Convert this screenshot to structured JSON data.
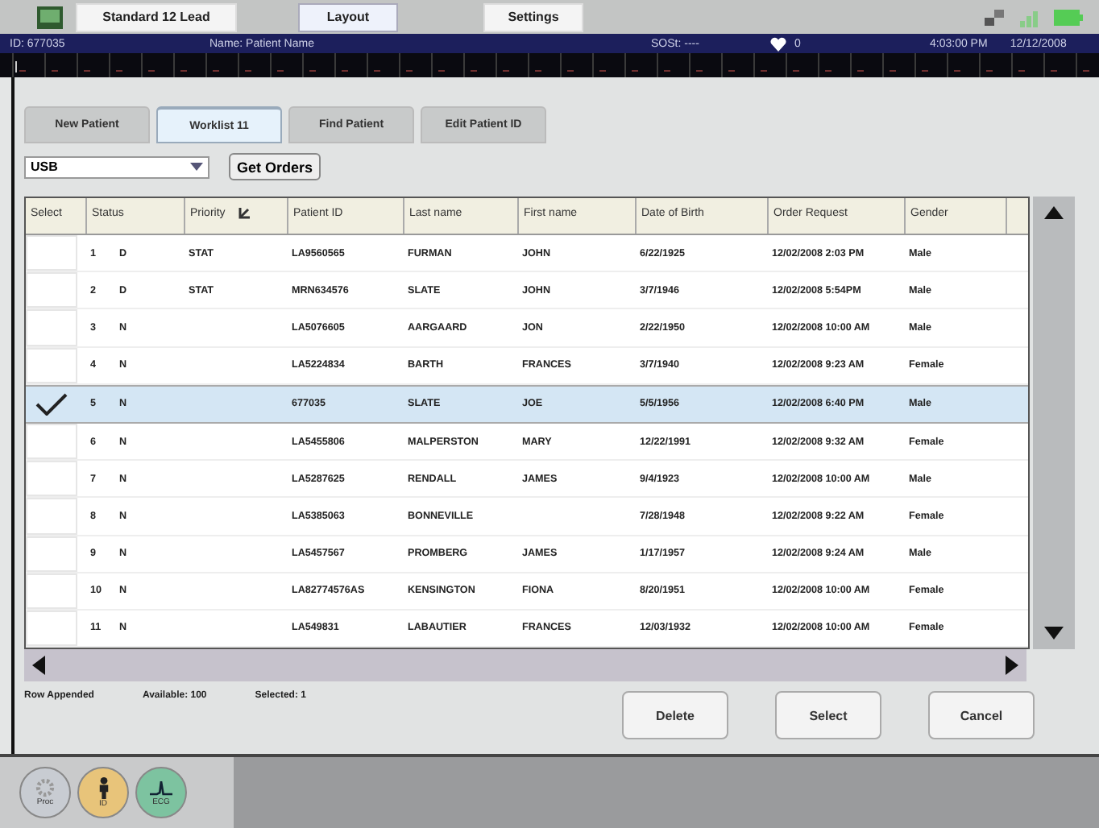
{
  "toolbar": {
    "buttons": [
      {
        "label": "Standard 12 Lead",
        "selected": false
      },
      {
        "label": "Layout",
        "selected": true
      },
      {
        "label": "Settings",
        "selected": false
      }
    ]
  },
  "info_bar": {
    "id": "ID: 677035",
    "name": "Name: Patient Name",
    "sost": "SOSt: ----",
    "heart_rate": "0",
    "time": "4:03:00 PM",
    "date": "12/12/2008"
  },
  "tabs": [
    {
      "label": "New Patient",
      "selected": false
    },
    {
      "label": "Worklist  11",
      "selected": true
    },
    {
      "label": "Find Patient",
      "selected": false
    },
    {
      "label": "Edit Patient ID",
      "selected": false
    }
  ],
  "source": {
    "value": "USB",
    "button": "Get Orders"
  },
  "table": {
    "columns": [
      "Select",
      "Status",
      "Priority",
      "Patient ID",
      "Last name",
      "First name",
      "Date of Birth",
      "Order Request",
      "Gender"
    ],
    "rows": [
      {
        "num": "1",
        "status": "D",
        "priority": "STAT",
        "patient_id": "LA9560565",
        "last": "FURMAN",
        "first": "JOHN",
        "dob": "6/22/1925",
        "order": "12/02/2008 2:03 PM",
        "gender": "Male",
        "checked": false,
        "selected": false
      },
      {
        "num": "2",
        "status": "D",
        "priority": "STAT",
        "patient_id": "MRN634576",
        "last": "SLATE",
        "first": "JOHN",
        "dob": "3/7/1946",
        "order": "12/02/2008 5:54PM",
        "gender": "Male",
        "checked": false,
        "selected": false
      },
      {
        "num": "3",
        "status": "N",
        "priority": "",
        "patient_id": "LA5076605",
        "last": "AARGAARD",
        "first": "JON",
        "dob": "2/22/1950",
        "order": "12/02/2008 10:00 AM",
        "gender": "Male",
        "checked": false,
        "selected": false
      },
      {
        "num": "4",
        "status": "N",
        "priority": "",
        "patient_id": "LA5224834",
        "last": "BARTH",
        "first": "FRANCES",
        "dob": "3/7/1940",
        "order": "12/02/2008 9:23 AM",
        "gender": "Female",
        "checked": false,
        "selected": false
      },
      {
        "num": "5",
        "status": "N",
        "priority": "",
        "patient_id": "677035",
        "last": "SLATE",
        "first": "JOE",
        "dob": "5/5/1956",
        "order": "12/02/2008 6:40 PM",
        "gender": "Male",
        "checked": true,
        "selected": true
      },
      {
        "num": "6",
        "status": "N",
        "priority": "",
        "patient_id": "LA5455806",
        "last": "MALPERSTON",
        "first": "MARY",
        "dob": "12/22/1991",
        "order": "12/02/2008 9:32 AM",
        "gender": "Female",
        "checked": false,
        "selected": false
      },
      {
        "num": "7",
        "status": "N",
        "priority": "",
        "patient_id": "LA5287625",
        "last": "RENDALL",
        "first": "JAMES",
        "dob": "9/4/1923",
        "order": "12/02/2008 10:00 AM",
        "gender": "Male",
        "checked": false,
        "selected": false
      },
      {
        "num": "8",
        "status": "N",
        "priority": "",
        "patient_id": "LA5385063",
        "last": "BONNEVILLE",
        "first": "",
        "dob": "7/28/1948",
        "order": "12/02/2008 9:22 AM",
        "gender": "Female",
        "checked": false,
        "selected": false
      },
      {
        "num": "9",
        "status": "N",
        "priority": "",
        "patient_id": "LA5457567",
        "last": "PROMBERG",
        "first": "JAMES",
        "dob": "1/17/1957",
        "order": "12/02/2008 9:24 AM",
        "gender": "Male",
        "checked": false,
        "selected": false
      },
      {
        "num": "10",
        "status": "N",
        "priority": "",
        "patient_id": "LA82774576AS",
        "last": "KENSINGTON",
        "first": "FIONA",
        "dob": "8/20/1951",
        "order": "12/02/2008 10:00 AM",
        "gender": "Female",
        "checked": false,
        "selected": false
      },
      {
        "num": "11",
        "status": "N",
        "priority": "",
        "patient_id": "LA549831",
        "last": "LABAUTIER",
        "first": "FRANCES",
        "dob": "12/03/1932",
        "order": "12/02/2008 10:00 AM",
        "gender": "Female",
        "checked": false,
        "selected": false
      }
    ]
  },
  "status_bar": [
    "Row Appended",
    "Available: 100",
    "Selected: 1"
  ],
  "buttons": [
    "Delete",
    "Select",
    "Cancel"
  ],
  "dock": [
    {
      "kind": "gear",
      "label": "Proc"
    },
    {
      "kind": "person",
      "label": "ID"
    },
    {
      "kind": "ecg",
      "label": "ECG"
    }
  ]
}
